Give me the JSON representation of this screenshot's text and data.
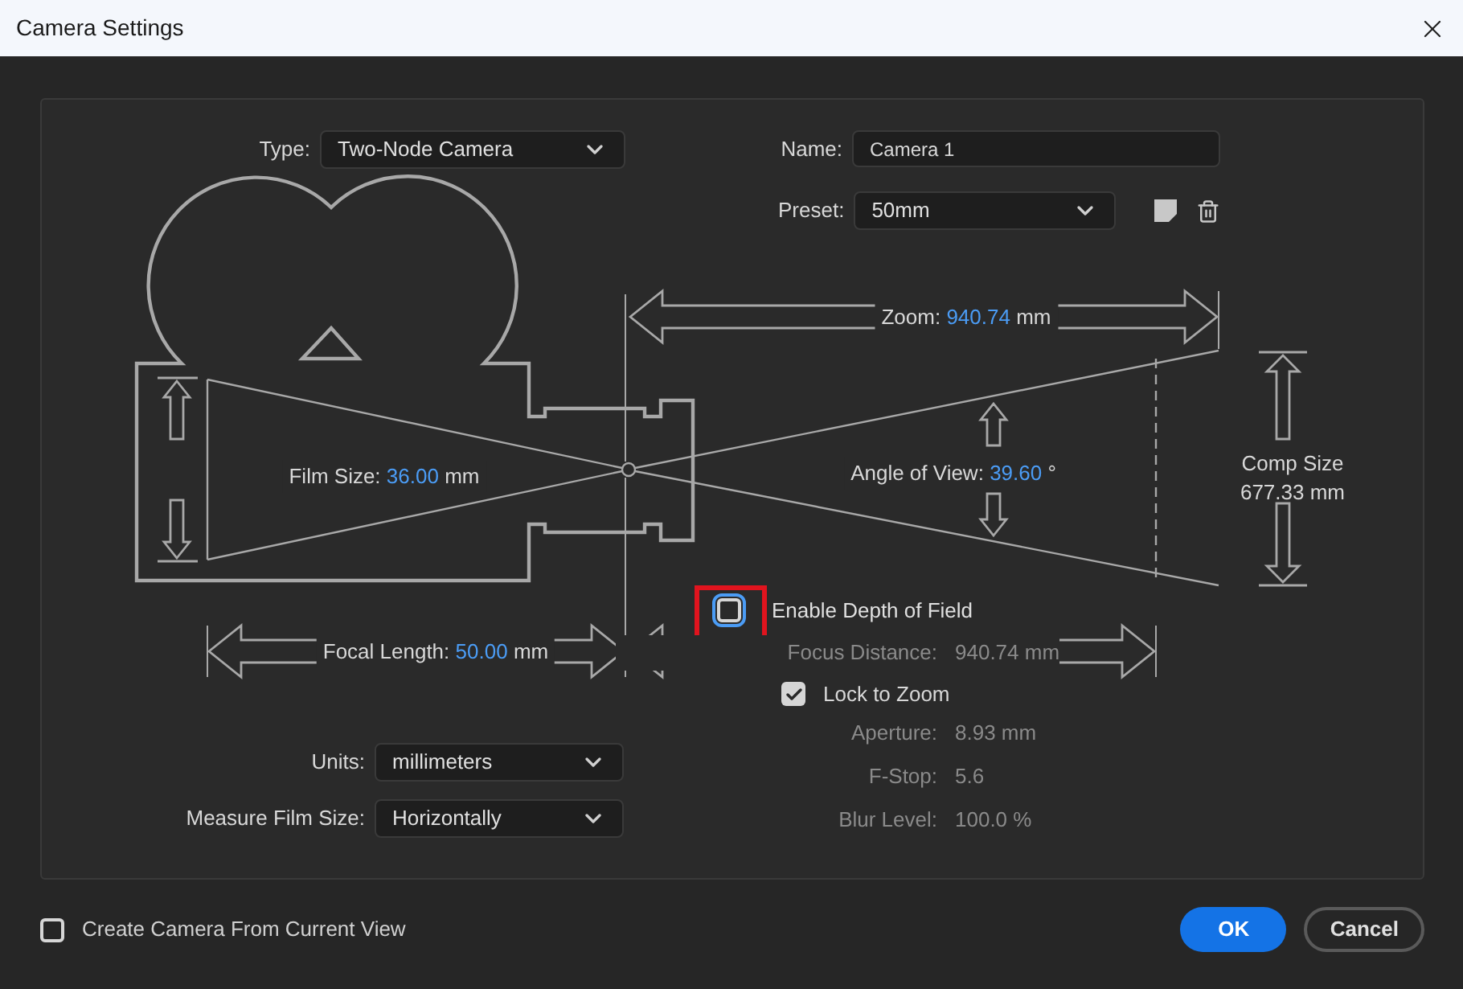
{
  "window": {
    "title": "Camera Settings"
  },
  "type": {
    "label": "Type:",
    "value": "Two-Node Camera"
  },
  "name": {
    "label": "Name:",
    "value": "Camera 1"
  },
  "preset": {
    "label": "Preset:",
    "value": "50mm"
  },
  "zoom": {
    "label": "Zoom:",
    "value": "940.74",
    "unit": "mm"
  },
  "film_size": {
    "label": "Film Size:",
    "value": "36.00",
    "unit": "mm"
  },
  "angle_of_view": {
    "label": "Angle of View:",
    "value": "39.60",
    "unit": "°"
  },
  "comp_size": {
    "label": "Comp Size",
    "value": "677.33 mm"
  },
  "focal_length": {
    "label": "Focal Length:",
    "value": "50.00",
    "unit": "mm"
  },
  "depth_of_field": {
    "label": "Enable Depth of Field",
    "checked": false,
    "highlighted": true
  },
  "focus_distance": {
    "label": "Focus Distance:",
    "value": "940.74 mm",
    "disabled": true
  },
  "lock_to_zoom": {
    "label": "Lock to Zoom",
    "checked": true
  },
  "dof_fields": [
    {
      "label": "Aperture:",
      "value": "8.93 mm",
      "disabled": true
    },
    {
      "label": "F-Stop:",
      "value": "5.6",
      "disabled": true
    },
    {
      "label": "Blur Level:",
      "value": "100.0 %",
      "disabled": true
    }
  ],
  "units": {
    "label": "Units:",
    "value": "millimeters"
  },
  "measure_film_size": {
    "label": "Measure Film Size:",
    "value": "Horizontally"
  },
  "create_from_view": {
    "label": "Create Camera From Current View",
    "checked": false
  },
  "buttons": [
    {
      "label": "OK",
      "kind": "primary"
    },
    {
      "label": "Cancel",
      "kind": "secondary"
    }
  ]
}
